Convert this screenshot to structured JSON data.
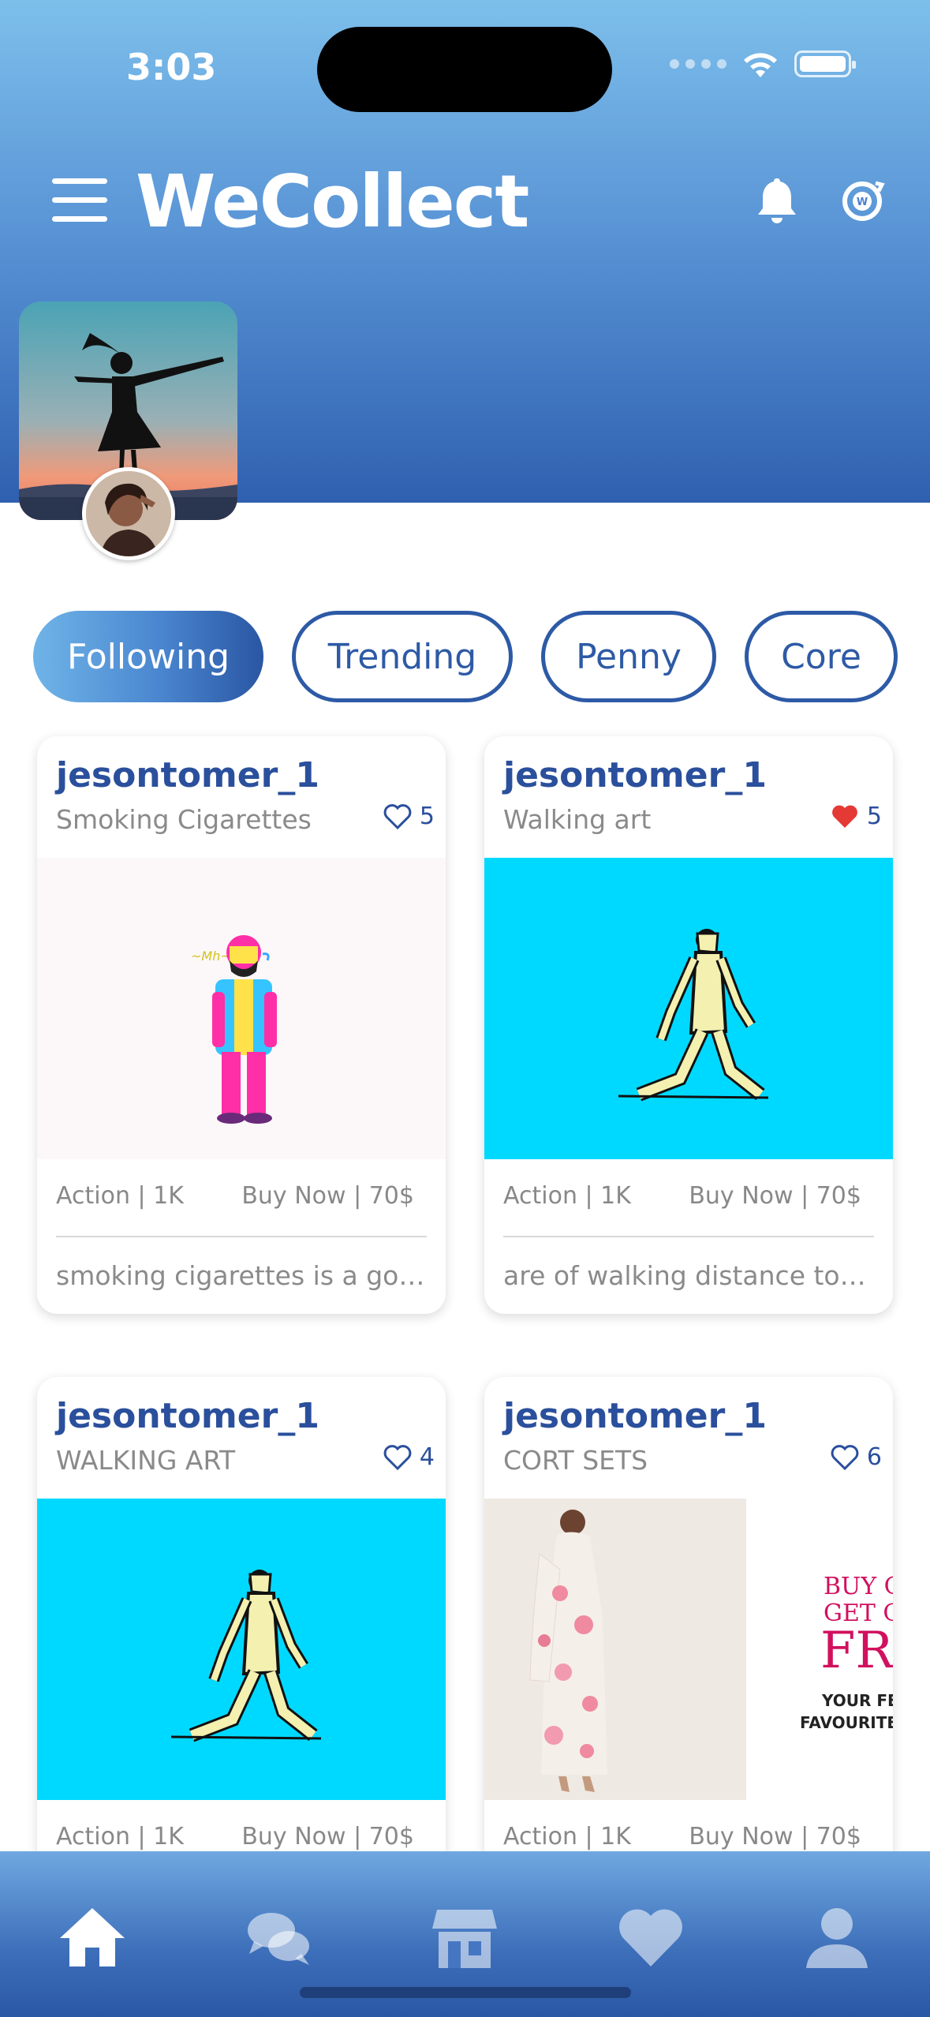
{
  "status_bar": {
    "time": "3:03"
  },
  "app": {
    "logo_text": "WeCollect"
  },
  "icons": {
    "menu": "hamburger-menu-icon",
    "notifications": "bell-icon",
    "coins": "coin-icon",
    "like": "heart-icon",
    "home": "home-icon",
    "chat": "chat-icon",
    "store": "store-icon",
    "favorites": "heart-icon",
    "profile": "person-icon"
  },
  "colors": {
    "accent": "#2a4f9c",
    "header_top": "#7dbfeb",
    "header_bottom": "#2f60b0",
    "liked_heart": "#e53935"
  },
  "tabs": [
    {
      "label": "Following",
      "active": true
    },
    {
      "label": "Trending",
      "active": false
    },
    {
      "label": "Penny",
      "active": false
    },
    {
      "label": "Core",
      "active": false
    }
  ],
  "posts": [
    {
      "username": "jesontomer_1",
      "title": "Smoking Cigarettes",
      "likes": "5",
      "liked": false,
      "action": "Action | 1K",
      "buy": "Buy Now | 70$",
      "description": "smoking cigarettes is a goo..."
    },
    {
      "username": "jesontomer_1",
      "title": "Walking art",
      "likes": "5",
      "liked": true,
      "action": "Action | 1K",
      "buy": "Buy Now | 70$",
      "description": "are of walking distance to t..."
    },
    {
      "username": "jesontomer_1",
      "title": "WALKING ART",
      "likes": "4",
      "liked": false,
      "action": "Action | 1K",
      "buy": "Buy Now | 70$"
    },
    {
      "username": "jesontomer_1",
      "title": "CORT SETS",
      "likes": "6",
      "liked": false,
      "action": "Action | 1K",
      "buy": "Buy Now | 70$",
      "ad_text": {
        "line1": "BUY ON",
        "line2": "GET ON",
        "line3": "FRE",
        "line4": "YOUR FEST",
        "line5": "FAVOURITES"
      }
    }
  ]
}
